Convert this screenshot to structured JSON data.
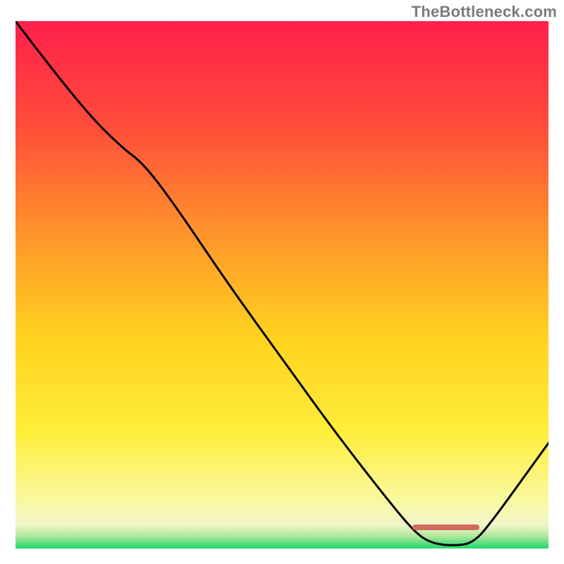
{
  "watermark": "TheBottleneck.com",
  "chart_data": {
    "type": "line",
    "title": "",
    "xlabel": "",
    "ylabel": "",
    "xlim": [
      0,
      100
    ],
    "ylim": [
      0,
      100
    ],
    "grid": false,
    "legend": false,
    "gradient_stops": [
      {
        "offset": 0.0,
        "color": "#ff1f4b"
      },
      {
        "offset": 0.2,
        "color": "#ff4d3a"
      },
      {
        "offset": 0.42,
        "color": "#ff9a2a"
      },
      {
        "offset": 0.6,
        "color": "#ffd21f"
      },
      {
        "offset": 0.78,
        "color": "#ffee3a"
      },
      {
        "offset": 0.9,
        "color": "#faf89a"
      },
      {
        "offset": 0.955,
        "color": "#f2f6c8"
      },
      {
        "offset": 0.975,
        "color": "#b8e8a0"
      },
      {
        "offset": 1.0,
        "color": "#1ed86b"
      }
    ],
    "curve_points_xy": [
      [
        0,
        100
      ],
      [
        6,
        92
      ],
      [
        14,
        82
      ],
      [
        20,
        76
      ],
      [
        24,
        73
      ],
      [
        30,
        65
      ],
      [
        40,
        50
      ],
      [
        50,
        36
      ],
      [
        60,
        22
      ],
      [
        70,
        9
      ],
      [
        75,
        3
      ],
      [
        78,
        1
      ],
      [
        82,
        0.5
      ],
      [
        86,
        1
      ],
      [
        90,
        6
      ],
      [
        95,
        13
      ],
      [
        100,
        20
      ]
    ],
    "marker_x_range": [
      74.5,
      87
    ],
    "marker_y": 1,
    "marker_color": "#d46a5f",
    "note": "x,y are in percent of the plot area (0,0 at bottom-left); y=100 is top. The curve is a bottleneck curve that falls from top-left, reaches ~0 around x≈80 (the sweet spot), then rises toward the right edge. Values are estimated from the image with no visible axis ticks."
  }
}
